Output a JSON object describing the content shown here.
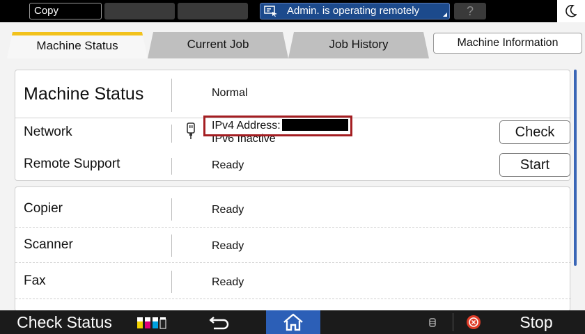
{
  "topbar": {
    "mode_label": "Copy",
    "remote_status": "Admin. is operating remotely",
    "help_label": "?"
  },
  "tabs": [
    {
      "label": "Machine Status",
      "active": true
    },
    {
      "label": "Current Job",
      "active": false
    },
    {
      "label": "Job History",
      "active": false
    },
    {
      "label": "Machine Information",
      "active": false
    }
  ],
  "status_panel": {
    "machine_status": {
      "label": "Machine Status",
      "value": "Normal"
    },
    "network": {
      "label": "Network",
      "ipv4_label": "IPv4 Address:",
      "ipv6_status": "IPv6 Inactive",
      "button": "Check"
    },
    "remote_support": {
      "label": "Remote Support",
      "value": "Ready",
      "button": "Start"
    }
  },
  "function_panel": [
    {
      "label": "Copier",
      "value": "Ready"
    },
    {
      "label": "Scanner",
      "value": "Ready"
    },
    {
      "label": "Fax",
      "value": "Ready"
    }
  ],
  "bottombar": {
    "check_status_label": "Check Status",
    "stop_label": "Stop"
  },
  "colors": {
    "active_tab_accent": "#f2c21c",
    "remote_bar": "#1c4a8c",
    "home_button": "#2c5fb7",
    "highlight_box": "#a41e22",
    "scrollbar": "#3a66b6"
  }
}
